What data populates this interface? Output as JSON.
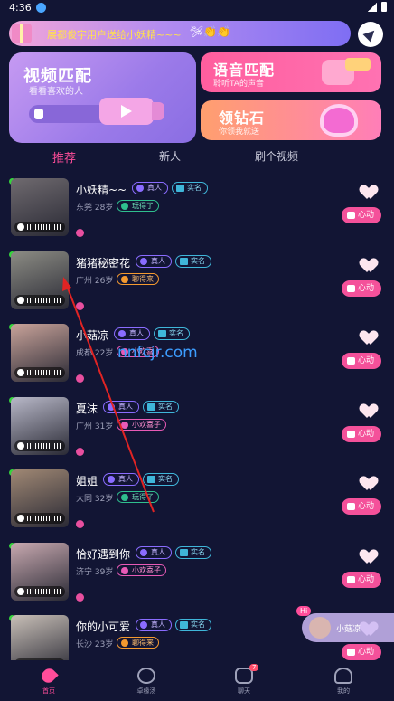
{
  "status_bar": {
    "time": "4:36"
  },
  "banner": {
    "text": "展都俊宇用户送给小妖精~~~",
    "emoji": "🛩👏👏"
  },
  "cards": {
    "video": {
      "title": "视频匹配",
      "subtitle": "看看喜欢的人"
    },
    "voice": {
      "title": "语音匹配",
      "subtitle": "聆听TA的声音"
    },
    "diamond": {
      "title": "领钻石",
      "subtitle": "你领我就送"
    }
  },
  "tabs": [
    {
      "label": "推荐",
      "active": true
    },
    {
      "label": "新人",
      "active": false
    },
    {
      "label": "刷个视频",
      "active": false
    }
  ],
  "badges": {
    "real": "真人",
    "verified": "实名"
  },
  "heart_button_label": "心动",
  "users": [
    {
      "name": "小妖精~~",
      "badges": [
        "真人",
        "实名"
      ],
      "meta": "东莞 28岁",
      "tag": "玩得了",
      "tag_color": "green",
      "photo": "#6f6a6f"
    },
    {
      "name": "猪猪秘密花",
      "badges": [
        "真人",
        "实名"
      ],
      "meta": "广州 26岁",
      "tag": "聊得来",
      "tag_color": "orange",
      "photo": "#8c8c84"
    },
    {
      "name": "小菇凉",
      "badges": [
        "真人",
        "实名"
      ],
      "meta": "成都 22岁",
      "tag": "小欢喜",
      "tag_color": "pink",
      "photo": "#c9a39a"
    },
    {
      "name": "夏沫",
      "badges": [
        "真人",
        "实名"
      ],
      "meta": "广州 31岁",
      "tag": "小欢喜子",
      "tag_color": "pink",
      "photo": "#b8b8c8"
    },
    {
      "name": "姐姐",
      "badges": [
        "真人",
        "实名"
      ],
      "meta": "大同 32岁",
      "tag": "玩得了",
      "tag_color": "green",
      "photo": "#a08874"
    },
    {
      "name": "恰好遇到你",
      "badges": [
        "真人",
        "实名"
      ],
      "meta": "济宁 39岁",
      "tag": "小欢喜子",
      "tag_color": "pink",
      "photo": "#c8a9b0"
    },
    {
      "name": "你的小可爱",
      "badges": [
        "真人",
        "实名"
      ],
      "meta": "长沙 23岁",
      "tag": "聊得来",
      "tag_color": "orange",
      "photo": "#c9c0b8"
    }
  ],
  "watermark": "nnfcjr.com",
  "floating_hi": {
    "hi": "Hi",
    "name": "小菇凉"
  },
  "nav": [
    {
      "label": "首页",
      "icon": "home-heart-icon",
      "active": true
    },
    {
      "label": "卓缘汤",
      "icon": "planet-icon",
      "active": false
    },
    {
      "label": "聊天",
      "icon": "chat-icon",
      "active": false,
      "badge": "7"
    },
    {
      "label": "我的",
      "icon": "user-icon",
      "active": false
    }
  ],
  "colors": {
    "accent": "#ff4d9a",
    "background": "#121534",
    "online": "#35d43c"
  }
}
